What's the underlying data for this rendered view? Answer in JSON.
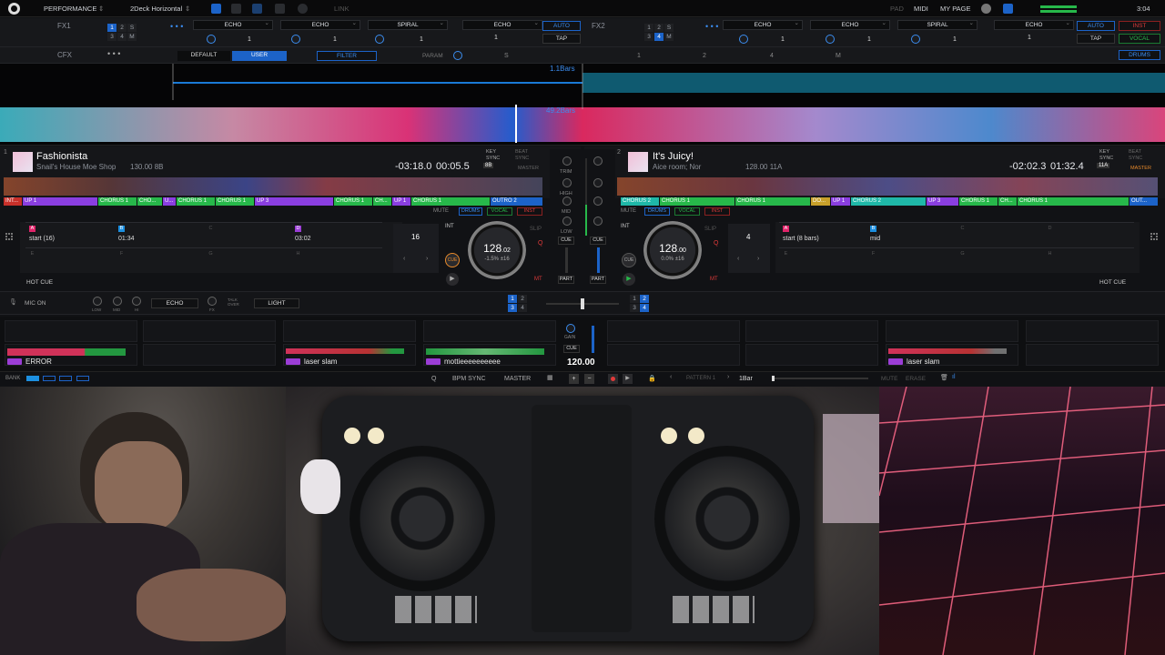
{
  "topbar": {
    "mode": "PERFORMANCE",
    "layout": "2Deck Horizontal",
    "link": "LINK",
    "pad": "PAD",
    "midi": "MIDI",
    "my_page": "MY PAGE",
    "clock": "3:04"
  },
  "fx1": {
    "label": "FX1",
    "grid": [
      "1",
      "2",
      "S",
      "3",
      "4",
      "M"
    ],
    "slots": [
      "ECHO",
      "ECHO",
      "SPIRAL"
    ],
    "beat_values": [
      "1",
      "1",
      "1"
    ],
    "main_slot": "ECHO",
    "main_beat": "1",
    "auto": "AUTO",
    "tap": "TAP"
  },
  "fx2": {
    "label": "FX2",
    "grid": [
      "1",
      "2",
      "S",
      "3",
      "4",
      "M"
    ],
    "slots": [
      "ECHO",
      "ECHO",
      "SPIRAL"
    ],
    "beat_values": [
      "1",
      "1",
      "1"
    ],
    "main_slot": "ECHO",
    "main_beat": "1",
    "auto": "AUTO",
    "tap": "TAP",
    "inst": "INST",
    "vocal": "VOCAL",
    "drums": "DRUMS"
  },
  "cfx": {
    "label": "CFX",
    "default": "DEFAULT",
    "user": "USER",
    "filter": "FILTER",
    "param": "PARAM",
    "params": [
      "S",
      "1",
      "2",
      "4",
      "M"
    ]
  },
  "overview": {
    "bars_top": "1.1Bars",
    "bars_bottom": "49.2Bars"
  },
  "deck1": {
    "number": "1",
    "title": "Fashionista",
    "artist": "Snail's House Moe Shop",
    "bpm_key": "130.00 8B",
    "key_sync": "KEY SYNC",
    "beat_sync": "BEAT SYNC",
    "master": "MASTER",
    "key": "8B",
    "remaining": "-03:18.0",
    "elapsed": "00:05.5",
    "mute": "MUTE",
    "drums": "DRUMS",
    "vocal": "VOCAL",
    "inst": "INST",
    "cues": [
      "INT...",
      "UP 1",
      "CHORUS 1",
      "CHO...",
      "U...",
      "CHORUS 1",
      "CHORUS 1",
      "UP 3",
      "CHORUS 1",
      "CH...",
      "UP 1",
      "CHORUS 1",
      "OUTRO 2"
    ],
    "pads": [
      {
        "letter": "A",
        "label": "start (16)",
        "color": "#e0246a"
      },
      {
        "letter": "B",
        "label": "01:34",
        "color": "#1c8fe0"
      },
      {
        "letter": "C",
        "label": "",
        "color": "#333"
      },
      {
        "letter": "D",
        "label": "03:02",
        "color": "#9b3dd6"
      },
      {
        "letter": "E",
        "label": "",
        "color": "#333"
      },
      {
        "letter": "F",
        "label": "",
        "color": "#333"
      },
      {
        "letter": "G",
        "label": "",
        "color": "#333"
      },
      {
        "letter": "H",
        "label": "",
        "color": "#333"
      }
    ],
    "loop": "16",
    "int": "INT",
    "slip": "SLIP",
    "bpm": "128",
    "bpm_dec": ".02",
    "pitch": "-1.5%",
    "range": "±16",
    "cue": "CUE",
    "hot_cue": "HOT CUE",
    "q": "Q",
    "mt": "MT"
  },
  "deck2": {
    "number": "2",
    "title": "It's Juicy!",
    "artist": "Aice room; Nor",
    "bpm_key": "128.00 11A",
    "key_sync": "KEY SYNC",
    "beat_sync": "BEAT SYNC",
    "master": "MASTER",
    "key": "11A",
    "remaining": "-02:02.3",
    "elapsed": "01:32.4",
    "mute": "MUTE",
    "drums": "DRUMS",
    "vocal": "VOCAL",
    "inst": "INST",
    "cues": [
      "CHORUS 2",
      "CHORUS 1",
      "CHORUS 1",
      "DO...",
      "UP 1",
      "CHORUS 2",
      "UP 3",
      "CHORUS 1",
      "CH...",
      "CHORUS 1",
      "OUT..."
    ],
    "pads": [
      {
        "letter": "A",
        "label": "start (8 bars)",
        "color": "#e0246a"
      },
      {
        "letter": "B",
        "label": "mid",
        "color": "#1c8fe0"
      },
      {
        "letter": "C",
        "label": "",
        "color": "#333"
      },
      {
        "letter": "D",
        "label": "",
        "color": "#333"
      },
      {
        "letter": "E",
        "label": "",
        "color": "#333"
      },
      {
        "letter": "F",
        "label": "",
        "color": "#333"
      },
      {
        "letter": "G",
        "label": "",
        "color": "#333"
      },
      {
        "letter": "H",
        "label": "",
        "color": "#333"
      }
    ],
    "loop": "4",
    "int": "INT",
    "slip": "SLIP",
    "bpm": "128",
    "bpm_dec": ".00",
    "pitch": "0.0%",
    "range": "±16",
    "cue": "CUE",
    "hot_cue": "HOT CUE",
    "q": "Q",
    "mt": "MT"
  },
  "mixer": {
    "trim": "TRIM",
    "high": "HIGH",
    "mid": "MID",
    "low": "LOW",
    "cue": "CUE",
    "part": "PART"
  },
  "mic": {
    "mic_on": "MIC ON",
    "low": "LOW",
    "mid": "MID",
    "hi": "HI",
    "effect": "ECHO",
    "fx": "FX",
    "talk_over": "TALK OVER",
    "light": "LIGHT"
  },
  "sampler": {
    "slots": [
      "ERROR",
      "laser slam",
      "mottieeeeeeeeee",
      "laser slam"
    ],
    "gain": "GAIN",
    "cue": "CUE",
    "bpm": "120.00",
    "bank": "BANK"
  },
  "bottom": {
    "q": "Q",
    "bpm_sync": "BPM SYNC",
    "master": "MASTER",
    "pattern": "PATTERN 1",
    "bar": "1Bar",
    "mute": "MUTE",
    "erase": "ERASE"
  },
  "colors": {
    "accent": "#1c63c8",
    "waveform_blue": "#2a9df4",
    "waveform_pink": "#e0246a",
    "cue_green": "#27b84a",
    "cue_purple": "#8a3ee0",
    "cue_teal": "#1fb8a8"
  }
}
